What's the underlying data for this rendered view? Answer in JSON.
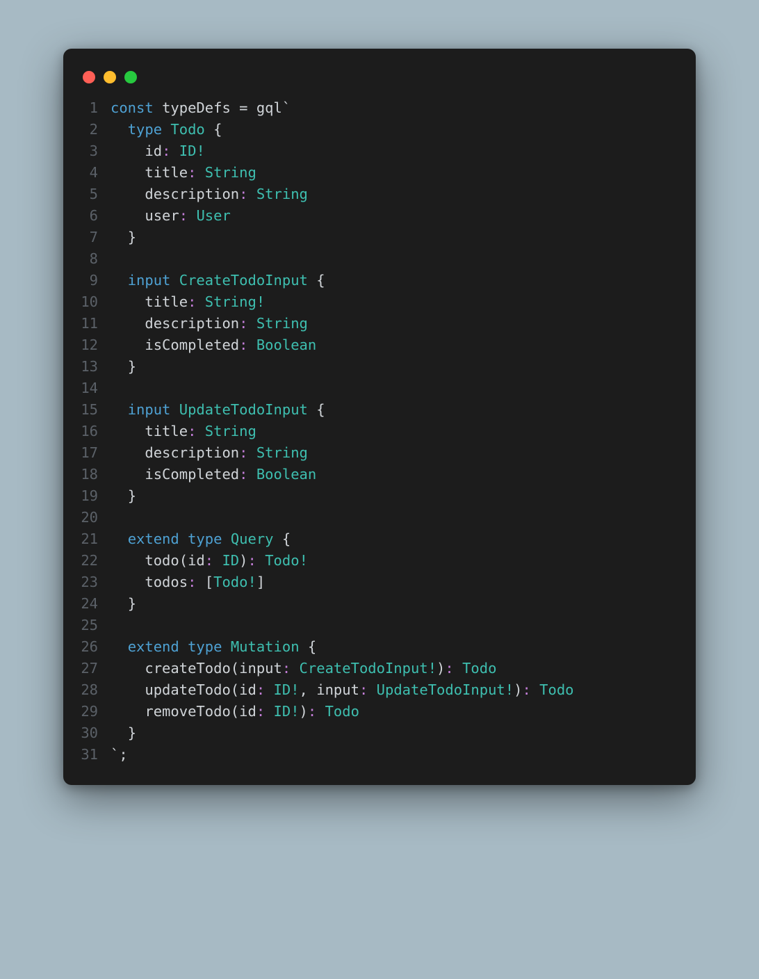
{
  "window": {
    "traffic_lights": [
      "red",
      "yellow",
      "green"
    ]
  },
  "code": {
    "lines": [
      {
        "n": "1",
        "tokens": [
          [
            "keyword",
            "const "
          ],
          [
            "ident",
            "typeDefs "
          ],
          [
            "op",
            "= "
          ],
          [
            "ident",
            "gql"
          ],
          [
            "punct",
            "`"
          ]
        ]
      },
      {
        "n": "2",
        "tokens": [
          [
            "plain",
            "  "
          ],
          [
            "keyword",
            "type "
          ],
          [
            "type",
            "Todo "
          ],
          [
            "brace",
            "{"
          ]
        ]
      },
      {
        "n": "3",
        "tokens": [
          [
            "plain",
            "    "
          ],
          [
            "ident",
            "id"
          ],
          [
            "colon",
            ": "
          ],
          [
            "type",
            "ID"
          ],
          [
            "bang",
            "!"
          ]
        ]
      },
      {
        "n": "4",
        "tokens": [
          [
            "plain",
            "    "
          ],
          [
            "ident",
            "title"
          ],
          [
            "colon",
            ": "
          ],
          [
            "type",
            "String"
          ]
        ]
      },
      {
        "n": "5",
        "tokens": [
          [
            "plain",
            "    "
          ],
          [
            "ident",
            "description"
          ],
          [
            "colon",
            ": "
          ],
          [
            "type",
            "String"
          ]
        ]
      },
      {
        "n": "6",
        "tokens": [
          [
            "plain",
            "    "
          ],
          [
            "ident",
            "user"
          ],
          [
            "colon",
            ": "
          ],
          [
            "type",
            "User"
          ]
        ]
      },
      {
        "n": "7",
        "tokens": [
          [
            "plain",
            "  "
          ],
          [
            "brace",
            "}"
          ]
        ]
      },
      {
        "n": "8",
        "tokens": [
          [
            "plain",
            ""
          ]
        ]
      },
      {
        "n": "9",
        "tokens": [
          [
            "plain",
            "  "
          ],
          [
            "keyword",
            "input "
          ],
          [
            "type",
            "CreateTodoInput "
          ],
          [
            "brace",
            "{"
          ]
        ]
      },
      {
        "n": "10",
        "tokens": [
          [
            "plain",
            "    "
          ],
          [
            "ident",
            "title"
          ],
          [
            "colon",
            ": "
          ],
          [
            "type",
            "String"
          ],
          [
            "bang",
            "!"
          ]
        ]
      },
      {
        "n": "11",
        "tokens": [
          [
            "plain",
            "    "
          ],
          [
            "ident",
            "description"
          ],
          [
            "colon",
            ": "
          ],
          [
            "type",
            "String"
          ]
        ]
      },
      {
        "n": "12",
        "tokens": [
          [
            "plain",
            "    "
          ],
          [
            "ident",
            "isCompleted"
          ],
          [
            "colon",
            ": "
          ],
          [
            "type",
            "Boolean"
          ]
        ]
      },
      {
        "n": "13",
        "tokens": [
          [
            "plain",
            "  "
          ],
          [
            "brace",
            "}"
          ]
        ]
      },
      {
        "n": "14",
        "tokens": [
          [
            "plain",
            ""
          ]
        ]
      },
      {
        "n": "15",
        "tokens": [
          [
            "plain",
            "  "
          ],
          [
            "keyword",
            "input "
          ],
          [
            "type",
            "UpdateTodoInput "
          ],
          [
            "brace",
            "{"
          ]
        ]
      },
      {
        "n": "16",
        "tokens": [
          [
            "plain",
            "    "
          ],
          [
            "ident",
            "title"
          ],
          [
            "colon",
            ": "
          ],
          [
            "type",
            "String"
          ]
        ]
      },
      {
        "n": "17",
        "tokens": [
          [
            "plain",
            "    "
          ],
          [
            "ident",
            "description"
          ],
          [
            "colon",
            ": "
          ],
          [
            "type",
            "String"
          ]
        ]
      },
      {
        "n": "18",
        "tokens": [
          [
            "plain",
            "    "
          ],
          [
            "ident",
            "isCompleted"
          ],
          [
            "colon",
            ": "
          ],
          [
            "type",
            "Boolean"
          ]
        ]
      },
      {
        "n": "19",
        "tokens": [
          [
            "plain",
            "  "
          ],
          [
            "brace",
            "}"
          ]
        ]
      },
      {
        "n": "20",
        "tokens": [
          [
            "plain",
            ""
          ]
        ]
      },
      {
        "n": "21",
        "tokens": [
          [
            "plain",
            "  "
          ],
          [
            "keyword",
            "extend "
          ],
          [
            "keyword",
            "type "
          ],
          [
            "type",
            "Query "
          ],
          [
            "brace",
            "{"
          ]
        ]
      },
      {
        "n": "22",
        "tokens": [
          [
            "plain",
            "    "
          ],
          [
            "ident",
            "todo"
          ],
          [
            "paren",
            "("
          ],
          [
            "ident",
            "id"
          ],
          [
            "colon",
            ": "
          ],
          [
            "type",
            "ID"
          ],
          [
            "paren",
            ")"
          ],
          [
            "colon",
            ": "
          ],
          [
            "type",
            "Todo"
          ],
          [
            "bang",
            "!"
          ]
        ]
      },
      {
        "n": "23",
        "tokens": [
          [
            "plain",
            "    "
          ],
          [
            "ident",
            "todos"
          ],
          [
            "colon",
            ": "
          ],
          [
            "paren",
            "["
          ],
          [
            "type",
            "Todo"
          ],
          [
            "bang",
            "!"
          ],
          [
            "paren",
            "]"
          ]
        ]
      },
      {
        "n": "24",
        "tokens": [
          [
            "plain",
            "  "
          ],
          [
            "brace",
            "}"
          ]
        ]
      },
      {
        "n": "25",
        "tokens": [
          [
            "plain",
            ""
          ]
        ]
      },
      {
        "n": "26",
        "tokens": [
          [
            "plain",
            "  "
          ],
          [
            "keyword",
            "extend "
          ],
          [
            "keyword",
            "type "
          ],
          [
            "type",
            "Mutation "
          ],
          [
            "brace",
            "{"
          ]
        ]
      },
      {
        "n": "27",
        "tokens": [
          [
            "plain",
            "    "
          ],
          [
            "ident",
            "createTodo"
          ],
          [
            "paren",
            "("
          ],
          [
            "ident",
            "input"
          ],
          [
            "colon",
            ": "
          ],
          [
            "type",
            "CreateTodoInput"
          ],
          [
            "bang",
            "!"
          ],
          [
            "paren",
            ")"
          ],
          [
            "colon",
            ": "
          ],
          [
            "type",
            "Todo"
          ]
        ]
      },
      {
        "n": "28",
        "tokens": [
          [
            "plain",
            "    "
          ],
          [
            "ident",
            "updateTodo"
          ],
          [
            "paren",
            "("
          ],
          [
            "ident",
            "id"
          ],
          [
            "colon",
            ": "
          ],
          [
            "type",
            "ID"
          ],
          [
            "bang",
            "!"
          ],
          [
            "punct",
            ", "
          ],
          [
            "ident",
            "input"
          ],
          [
            "colon",
            ": "
          ],
          [
            "type",
            "UpdateTodoInput"
          ],
          [
            "bang",
            "!"
          ],
          [
            "paren",
            ")"
          ],
          [
            "colon",
            ": "
          ],
          [
            "type",
            "Todo"
          ]
        ]
      },
      {
        "n": "29",
        "tokens": [
          [
            "plain",
            "    "
          ],
          [
            "ident",
            "removeTodo"
          ],
          [
            "paren",
            "("
          ],
          [
            "ident",
            "id"
          ],
          [
            "colon",
            ": "
          ],
          [
            "type",
            "ID"
          ],
          [
            "bang",
            "!"
          ],
          [
            "paren",
            ")"
          ],
          [
            "colon",
            ": "
          ],
          [
            "type",
            "Todo"
          ]
        ]
      },
      {
        "n": "30",
        "tokens": [
          [
            "plain",
            "  "
          ],
          [
            "brace",
            "}"
          ]
        ]
      },
      {
        "n": "31",
        "tokens": [
          [
            "punct",
            "`"
          ],
          [
            "punct",
            ";"
          ]
        ]
      }
    ]
  },
  "token_classes": {
    "keyword": "c-keyword",
    "ident": "c-ident",
    "type": "c-type",
    "punct": "c-punct",
    "op": "c-op",
    "colon": "c-colon",
    "bang": "c-bang",
    "brace": "c-brace",
    "paren": "c-paren",
    "plain": "c-default"
  }
}
